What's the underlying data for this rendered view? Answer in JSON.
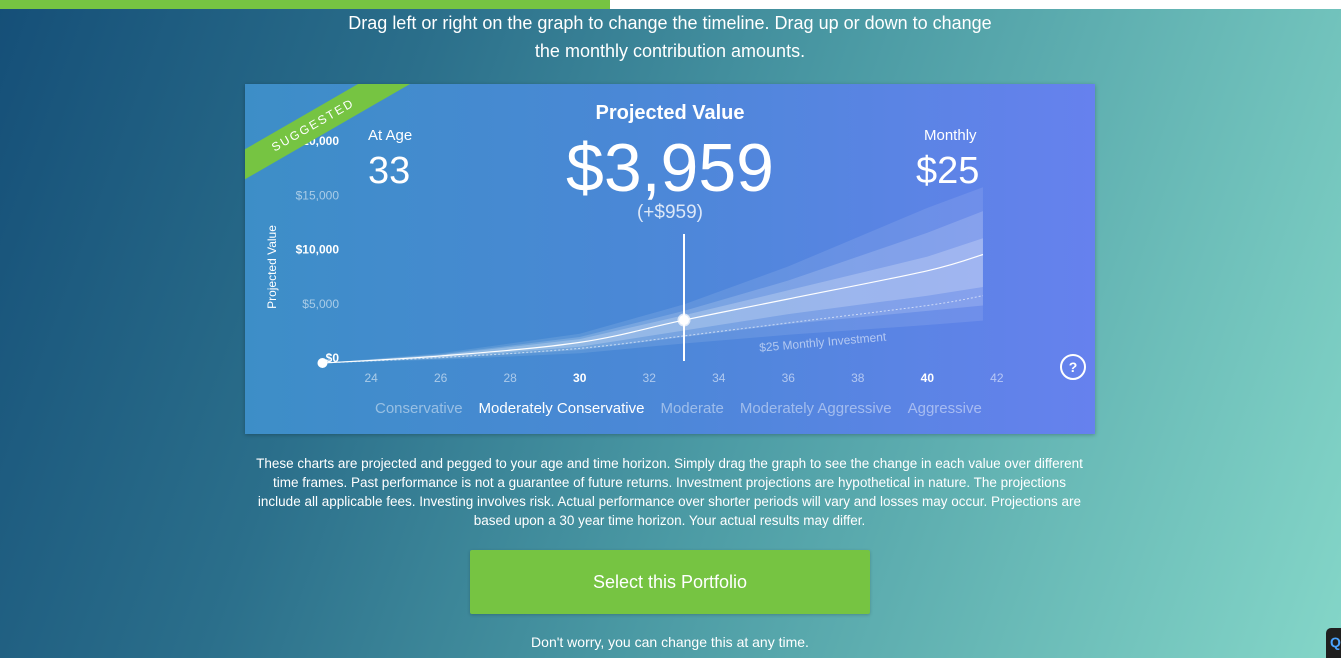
{
  "progress": {
    "fraction": 0.455
  },
  "instructions": "Drag left or right on the graph to change the timeline. Drag up or down to change the monthly contribution amounts.",
  "card": {
    "ribbon": "SUGGESTED",
    "at_age_label": "At Age",
    "at_age_value": "33",
    "title": "Projected Value",
    "value": "$3,959",
    "change": "(+$959)",
    "monthly_label": "Monthly",
    "monthly_value": "$25",
    "help": "?",
    "risk_levels": [
      "Conservative",
      "Moderately Conservative",
      "Moderate",
      "Moderately Aggressive",
      "Aggressive"
    ],
    "selected_risk": "Moderately Conservative"
  },
  "chart_data": {
    "type": "area",
    "ylabel": "Projected Value",
    "y_ticks": [
      "$0",
      "$5,000",
      "$10,000",
      "$15,000",
      "$20,000"
    ],
    "ylim": [
      0,
      20000
    ],
    "x_ticks": [
      24,
      26,
      28,
      30,
      32,
      34,
      36,
      38,
      40,
      42
    ],
    "highlighted_x_ticks": [
      30,
      40
    ],
    "xlim": [
      22.5,
      43.5
    ],
    "selected_age": 33,
    "annotation": "$25 Monthly Investment",
    "series": [
      {
        "x": [
          22.6,
          26,
          30,
          33,
          36,
          40,
          41.6
        ],
        "values": [
          0,
          650,
          1900,
          3959,
          5900,
          8500,
          10000
        ]
      },
      {
        "x": [
          22.6,
          26,
          30,
          33,
          36,
          40,
          41.6
        ],
        "values": [
          0,
          500,
          1350,
          2500,
          3700,
          5300,
          6200
        ]
      }
    ],
    "bands": [
      {
        "x": [
          22.6,
          26,
          30,
          33,
          36,
          40,
          41.6
        ],
        "low": [
          0,
          300,
          900,
          1800,
          2600,
          3500,
          3900
        ],
        "high": [
          0,
          900,
          2700,
          5400,
          8900,
          14300,
          16200
        ]
      },
      {
        "x": [
          22.6,
          26,
          30,
          33,
          36,
          40,
          41.6
        ],
        "low": [
          0,
          400,
          1200,
          2400,
          3600,
          4800,
          5300
        ],
        "high": [
          0,
          800,
          2400,
          4800,
          7600,
          12000,
          14000
        ]
      },
      {
        "x": [
          22.6,
          26,
          30,
          33,
          36,
          40,
          41.6
        ],
        "low": [
          0,
          500,
          1500,
          3000,
          4500,
          6200,
          7000
        ],
        "high": [
          0,
          750,
          2200,
          4400,
          6700,
          9800,
          11500
        ]
      }
    ]
  },
  "disclaimer": "These charts are projected and pegged to your age and time horizon. Simply drag the graph to see the change in each value over different time frames. Past performance is not a guarantee of future returns. Investment projections are hypothetical in nature. The projections include all applicable fees. Investing involves risk. Actual performance over shorter periods will vary and losses may occur. Projections are based upon a 30 year time horizon. Your actual results may differ.",
  "select_button": "Select this Portfolio",
  "reassurance": "Don't worry, you can change this at any time.",
  "corner_widget_label": "Q"
}
